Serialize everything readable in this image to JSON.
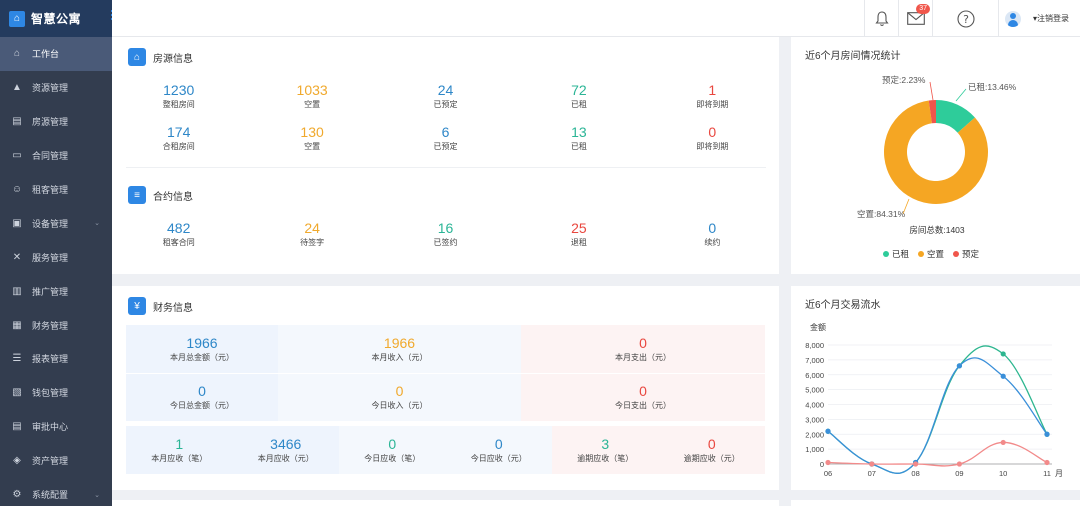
{
  "brand": {
    "name": "智慧公寓",
    "icon": "home-icon"
  },
  "sidebar": {
    "items": [
      {
        "label": "工作台",
        "icon": "home-outline-icon",
        "active": true
      },
      {
        "label": "资源管理",
        "icon": "building-icon"
      },
      {
        "label": "房源管理",
        "icon": "house-icon"
      },
      {
        "label": "合同管理",
        "icon": "printer-icon"
      },
      {
        "label": "租客管理",
        "icon": "people-icon"
      },
      {
        "label": "设备管理",
        "icon": "monitor-icon",
        "chevron": true
      },
      {
        "label": "服务管理",
        "icon": "tools-icon"
      },
      {
        "label": "推广管理",
        "icon": "chart-icon"
      },
      {
        "label": "财务管理",
        "icon": "ledger-icon"
      },
      {
        "label": "报表管理",
        "icon": "report-icon"
      },
      {
        "label": "钱包管理",
        "icon": "wallet-icon"
      },
      {
        "label": "审批中心",
        "icon": "document-icon"
      },
      {
        "label": "资产管理",
        "icon": "asset-icon"
      },
      {
        "label": "系统配置",
        "icon": "gear-icon",
        "chevron": true
      }
    ]
  },
  "header": {
    "notifications_icon": "bell-icon",
    "mail_icon": "mail-icon",
    "mail_badge": "37",
    "help_icon": "help-icon",
    "logout_label": "▾注销登录"
  },
  "housing": {
    "title": "房源信息",
    "rows": [
      [
        {
          "value": "1230",
          "label": "整租房间",
          "color": "#2e87c8"
        },
        {
          "value": "1033",
          "label": "空置",
          "color": "#f0a92d"
        },
        {
          "value": "24",
          "label": "已预定",
          "color": "#2e87c8"
        },
        {
          "value": "72",
          "label": "已租",
          "color": "#2bb596"
        },
        {
          "value": "1",
          "label": "即将到期",
          "color": "#e9473f"
        }
      ],
      [
        {
          "value": "174",
          "label": "合租房间",
          "color": "#2e87c8"
        },
        {
          "value": "130",
          "label": "空置",
          "color": "#f0a92d"
        },
        {
          "value": "6",
          "label": "已预定",
          "color": "#2e87c8"
        },
        {
          "value": "13",
          "label": "已租",
          "color": "#2bb596"
        },
        {
          "value": "0",
          "label": "即将到期",
          "color": "#e9473f"
        }
      ]
    ]
  },
  "contract": {
    "title": "合约信息",
    "row": [
      {
        "value": "482",
        "label": "租客合同",
        "color": "#2e87c8"
      },
      {
        "value": "24",
        "label": "待签字",
        "color": "#f0a92d"
      },
      {
        "value": "16",
        "label": "已签约",
        "color": "#2bb596"
      },
      {
        "value": "25",
        "label": "退租",
        "color": "#e9473f"
      },
      {
        "value": "0",
        "label": "续约",
        "color": "#2e87c8"
      }
    ]
  },
  "finance": {
    "title": "财务信息",
    "month_total": {
      "value": "1966",
      "label": "本月总金额（元）"
    },
    "month_income": {
      "value": "1966",
      "label": "本月收入（元）"
    },
    "month_expense": {
      "value": "0",
      "label": "本月支出（元）"
    },
    "day_total": {
      "value": "0",
      "label": "今日总金额（元）"
    },
    "day_income": {
      "value": "0",
      "label": "今日收入（元）"
    },
    "day_expense": {
      "value": "0",
      "label": "今日支出（元）"
    },
    "receivables": [
      {
        "value": "1",
        "label": "本月应收（笔）",
        "color": "#2bb596"
      },
      {
        "value": "3466",
        "label": "本月应收（元）",
        "color": "#2e87c8"
      },
      {
        "value": "0",
        "label": "今日应收（笔）",
        "color": "#2bb596"
      },
      {
        "value": "0",
        "label": "今日应收（元）",
        "color": "#2e87c8"
      },
      {
        "value": "3",
        "label": "逾期应收（笔）",
        "color": "#2bb596"
      },
      {
        "value": "0",
        "label": "逾期应收（元）",
        "color": "#e9473f"
      }
    ]
  },
  "room_chart_title": "近6个月房间情况统计",
  "flow_chart_title": "近6个月交易流水",
  "chart_data": [
    {
      "type": "pie",
      "title": "近6个月房间情况统计",
      "center_text": "房间总数:1403",
      "slices": [
        {
          "name": "已租",
          "value": 13.46,
          "label": "已租:13.46%",
          "color": "#2ecc9a"
        },
        {
          "name": "空置",
          "value": 84.31,
          "label": "空置:84.31%",
          "color": "#f5a623"
        },
        {
          "name": "预定",
          "value": 2.23,
          "label": "预定:2.23%",
          "color": "#f0564b"
        }
      ],
      "legend": [
        "已租",
        "空置",
        "预定"
      ],
      "legend_position": "bottom"
    },
    {
      "type": "line",
      "title": "近6个月交易流水",
      "ylabel": "金额",
      "xlabel": "月",
      "categories": [
        "06",
        "07",
        "08",
        "09",
        "10",
        "11"
      ],
      "ylim": [
        0,
        8000
      ],
      "yticks": [
        "0",
        "1,000",
        "2,000",
        "3,000",
        "4,000",
        "5,000",
        "6,000",
        "7,000",
        "8,000"
      ],
      "series": [
        {
          "values": [
            2200,
            0,
            100,
            6600,
            7400,
            2000
          ],
          "color": "#2db68f"
        },
        {
          "values": [
            2200,
            0,
            100,
            6600,
            5900,
            2000
          ],
          "color": "#3a8fd9"
        },
        {
          "values": [
            100,
            0,
            0,
            0,
            1450,
            100
          ],
          "color": "#f28a8a"
        }
      ]
    }
  ]
}
